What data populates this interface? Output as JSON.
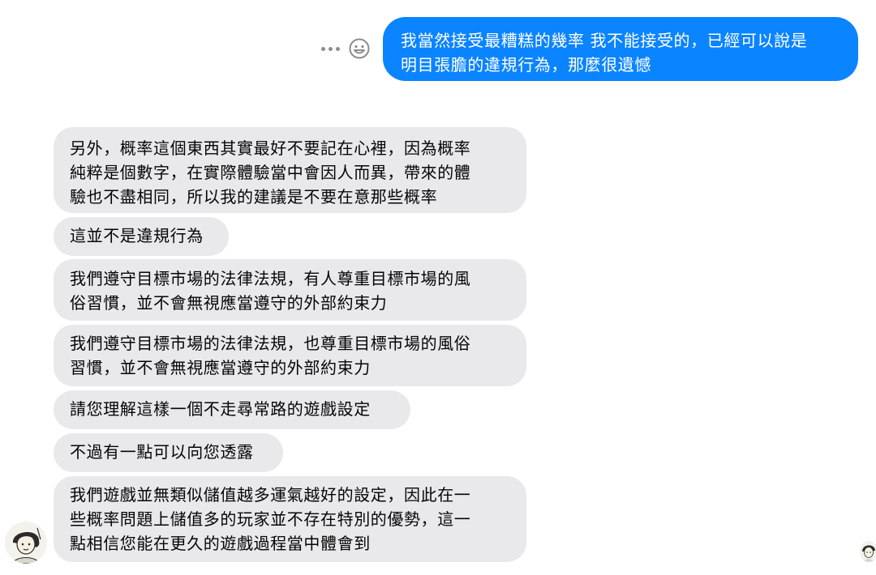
{
  "outgoing": {
    "message_1": {
      "line_1": "我當然接受最糟糕的幾率 我不能接受的，已經可以說是",
      "line_2": "明目張膽的違規行為，那麼很遺憾"
    }
  },
  "incoming": [
    {
      "lines": [
        "另外，概率這個東西其實最好不要記在心裡，因為概率",
        "純粹是個數字，在實際體驗當中會因人而異，帶來的體",
        "驗也不盡相同，所以我的建議是不要在意那些概率"
      ]
    },
    {
      "lines": [
        "這並不是違規行為"
      ]
    },
    {
      "lines": [
        "我們遵守目標市場的法律法規，有人尊重目標市場的風",
        "俗習慣，並不會無視應當遵守的外部約束力"
      ]
    },
    {
      "lines": [
        "我們遵守目標市場的法律法規，也尊重目標市場的風俗",
        "習慣，並不會無視應當遵守的外部約束力"
      ]
    },
    {
      "lines": [
        "請您理解這樣一個不走尋常路的遊戲設定"
      ]
    },
    {
      "lines": [
        "不過有一點可以向您透露"
      ]
    },
    {
      "lines": [
        "我們遊戲並無類似儲值越多運氣越好的設定，因此在一",
        "些概率問題上儲值多的玩家並不存在特別的優勢，這一",
        "點相信您能在更久的遊戲過程當中體會到"
      ]
    }
  ],
  "icons": {
    "more": "more-horizontal-icon",
    "emoji": "smiley-face-icon"
  },
  "colors": {
    "outgoing_bubble": "#0b84ff",
    "incoming_bubble": "#e9e9eb",
    "icon_gray": "#8a8d91"
  }
}
